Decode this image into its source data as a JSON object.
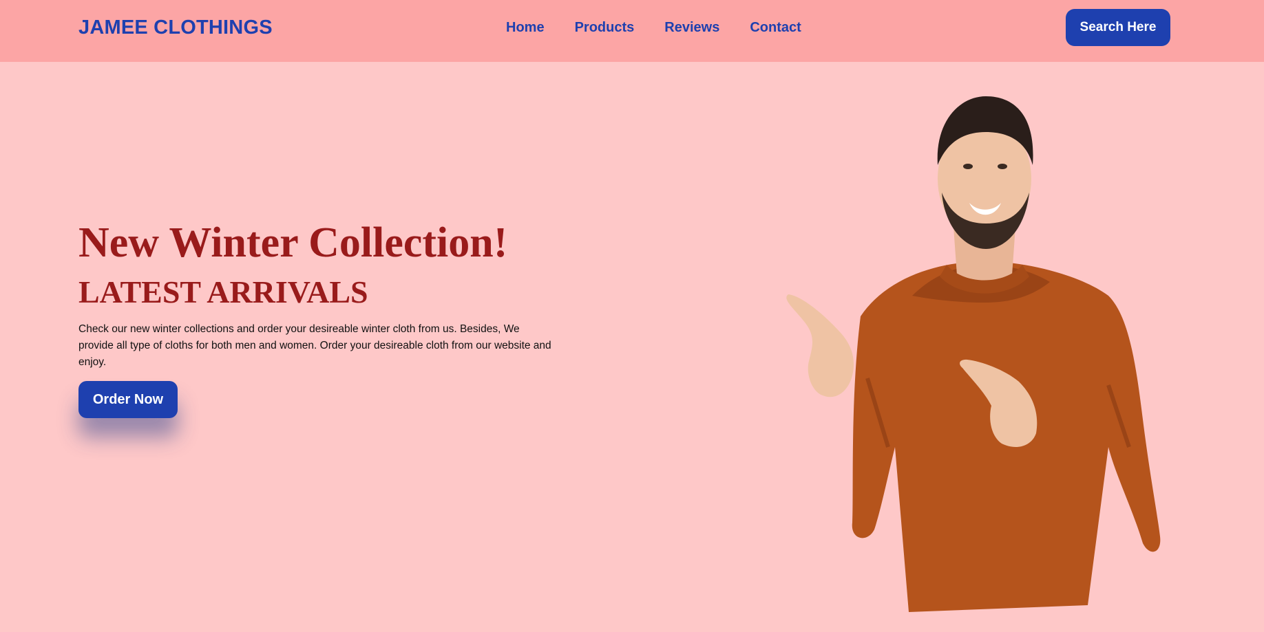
{
  "navbar": {
    "brand": "JAMEE CLOTHINGS",
    "links": [
      {
        "label": "Home"
      },
      {
        "label": "Products"
      },
      {
        "label": "Reviews"
      },
      {
        "label": "Contact"
      }
    ],
    "search_label": "Search Here"
  },
  "hero": {
    "title": "New Winter Collection!",
    "subtitle": "LATEST ARRIVALS",
    "description": "Check our new winter collections and order your desireable winter cloth from us. Besides, We provide all type of cloths for both men and women. Order your desireable cloth from our website and enjoy.",
    "cta_label": "Order Now",
    "image": "man-in-orange-sweater-pointing-photo"
  },
  "colors": {
    "page_bg": "#fec8c8",
    "navbar_bg": "#fca5a5",
    "accent_blue": "#1e40af",
    "heading_red": "#991b1b",
    "sweater_orange": "#b5541c"
  }
}
